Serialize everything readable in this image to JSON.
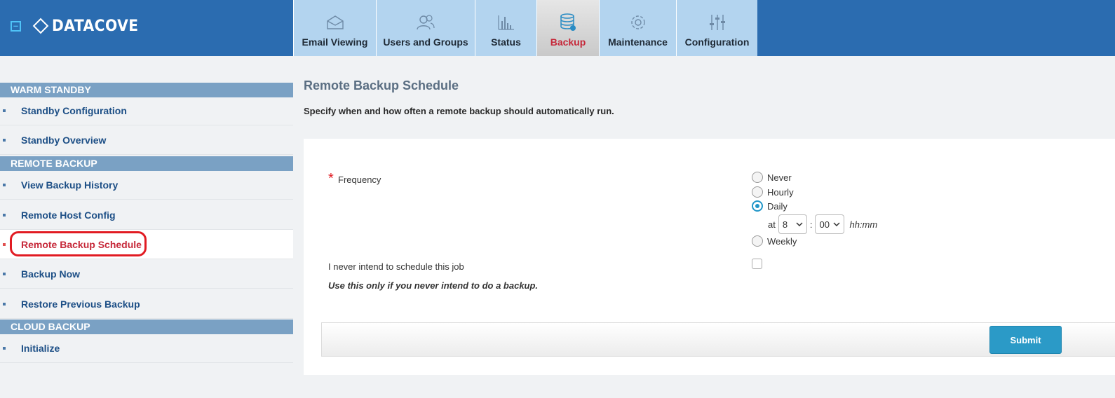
{
  "header": {
    "collapse_icon": "collapse-square-icon",
    "brand": "DATACOVE",
    "accent_color": "#2b6cb0"
  },
  "tabs": [
    {
      "label": "Email Viewing",
      "icon": "envelope-icon"
    },
    {
      "label": "Users and Groups",
      "icon": "users-icon"
    },
    {
      "label": "Status",
      "icon": "bar-chart-icon"
    },
    {
      "label": "Backup",
      "icon": "database-icon",
      "active": true
    },
    {
      "label": "Maintenance",
      "icon": "gear-icon"
    },
    {
      "label": "Configuration",
      "icon": "sliders-icon"
    }
  ],
  "sidebar": {
    "sections": [
      {
        "title": "WARM STANDBY",
        "items": [
          "Standby Configuration",
          "Standby Overview"
        ]
      },
      {
        "title": "REMOTE BACKUP",
        "items": [
          "View Backup History",
          "Remote Host Config",
          "Remote Backup Schedule",
          "Backup Now",
          "Restore Previous Backup"
        ]
      },
      {
        "title": "CLOUD BACKUP",
        "items": [
          "Initialize"
        ]
      }
    ],
    "selected": "Remote Backup Schedule"
  },
  "main": {
    "title": "Remote Backup Schedule",
    "description": "Specify when and how often a remote backup should automatically run.",
    "frequency": {
      "required_marker": "*",
      "label": "Frequency",
      "options": [
        "Never",
        "Hourly",
        "Daily",
        "Weekly"
      ],
      "selected": "Daily",
      "at_label": "at",
      "hour": "8",
      "separator": ":",
      "minute": "00",
      "format_hint": "hh:mm"
    },
    "never_schedule": {
      "label": "I never intend to schedule this job",
      "checked": false,
      "note": "Use this only if you never intend to do a backup."
    },
    "submit_label": "Submit"
  }
}
